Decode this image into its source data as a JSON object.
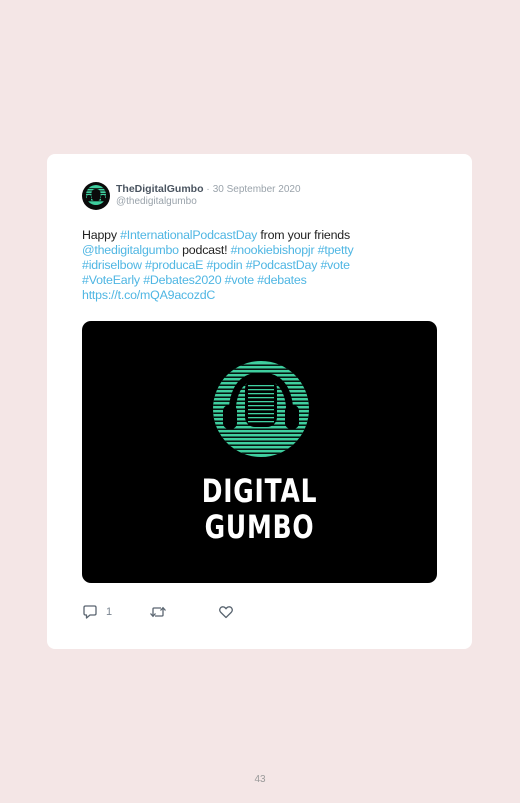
{
  "tweet": {
    "display_name": "TheDigitalGumbo",
    "separator": "·",
    "date": "30 September 2020",
    "handle": "@thedigitalgumbo",
    "text": {
      "t1": "Happy ",
      "t2": "#InternationalPodcastDay",
      "t3": " from your friends ",
      "t4": "@thedigitalgumbo",
      "t5": " podcast! ",
      "t6": "#nookiebishopjr",
      "t7": " ",
      "t8": "#tpetty",
      "t9": " ",
      "t10": "#idriselbow",
      "t11": " ",
      "t12": "#producaE",
      "t13": " ",
      "t14": "#podin",
      "t15": " ",
      "t16": "#PodcastDay",
      "t17": " ",
      "t18": "#vote",
      "t19": " ",
      "t20": "#VoteEarly",
      "t21": " ",
      "t22": "#Debates2020",
      "t23": " ",
      "t24": "#vote",
      "t25": " ",
      "t26": "#debates",
      "t27": " ",
      "t28": "https://t.co/mQA9acozdC"
    },
    "media": {
      "logo_line1": "DIGITAL",
      "logo_line2": "GUMBO",
      "icon": "headphones-icon",
      "accent_color": "#3fcf9f"
    },
    "actions": {
      "reply_icon": "reply-icon",
      "reply_count": "1",
      "retweet_icon": "retweet-icon",
      "like_icon": "heart-icon"
    }
  },
  "page": {
    "number": "43"
  },
  "colors": {
    "background": "#f4e6e6",
    "link": "#4fb6e3",
    "card": "#ffffff"
  }
}
